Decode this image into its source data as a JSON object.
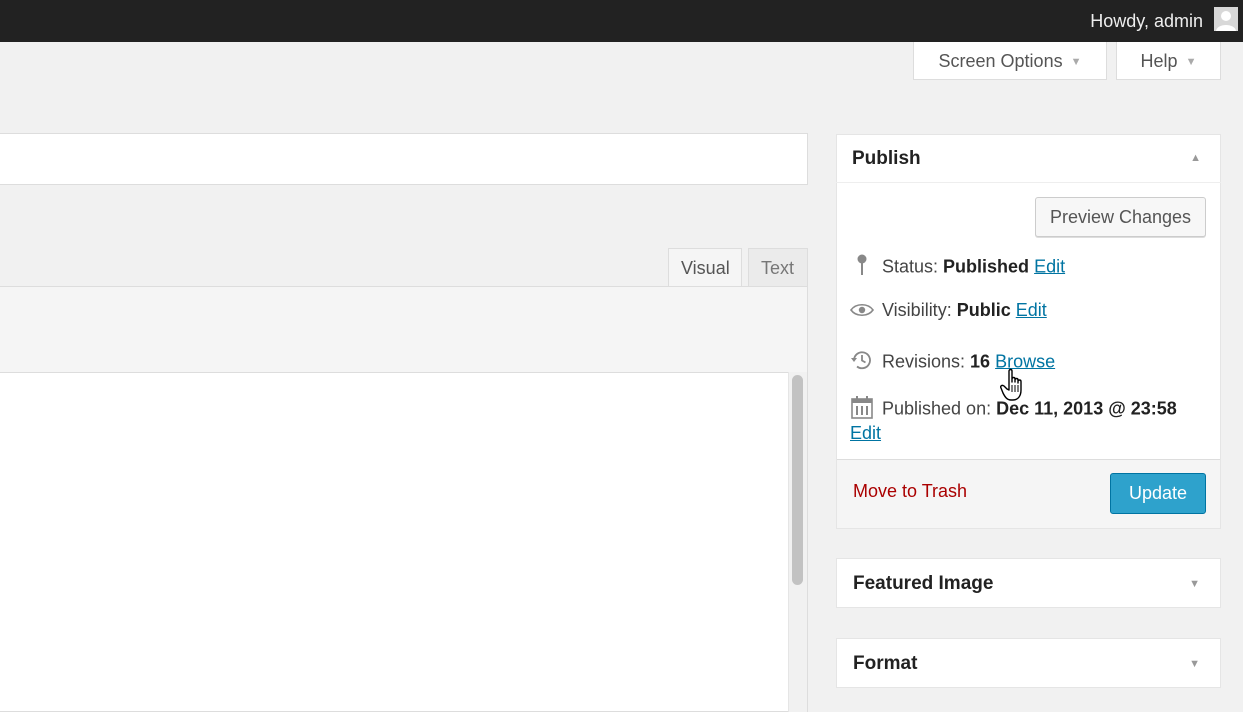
{
  "admin_bar": {
    "greeting": "Howdy, admin"
  },
  "screen_meta": {
    "screen_options_label": "Screen Options",
    "help_label": "Help"
  },
  "editor": {
    "title_value": "",
    "tabs": [
      {
        "label": "Visual",
        "active": true
      },
      {
        "label": "Text",
        "active": false
      }
    ]
  },
  "publish_box": {
    "title": "Publish",
    "preview_label": "Preview Changes",
    "status": {
      "label": "Status:",
      "value": "Published",
      "link": "Edit"
    },
    "visibility": {
      "label": "Visibility:",
      "value": "Public",
      "link": "Edit"
    },
    "revisions": {
      "label": "Revisions:",
      "value": "16",
      "link": "Browse"
    },
    "published_on": {
      "label": "Published on:",
      "value": "Dec 11, 2013 @ 23:58",
      "link": "Edit"
    },
    "trash_label": "Move to Trash",
    "update_label": "Update"
  },
  "featured_image": {
    "title": "Featured Image"
  },
  "format": {
    "title": "Format"
  },
  "colors": {
    "admin_bar": "#222222",
    "primary_button": "#2ea2cc",
    "link": "#0074a2",
    "trash": "#aa0000"
  },
  "icons": [
    "user-avatar-icon",
    "pin-icon",
    "eye-icon",
    "history-icon",
    "calendar-icon",
    "hand-cursor-icon"
  ]
}
